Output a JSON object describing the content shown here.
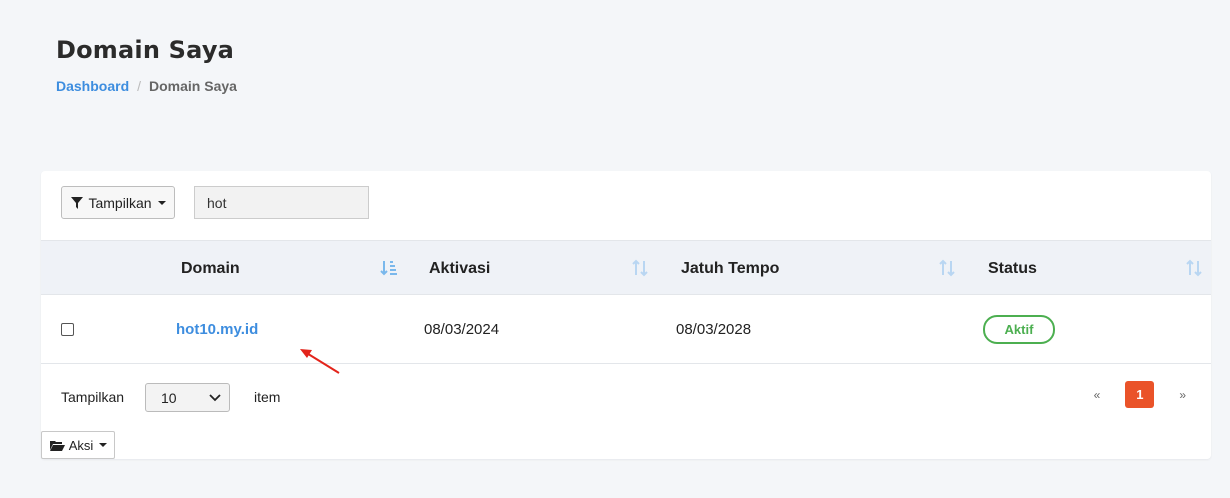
{
  "header": {
    "title": "Domain Saya",
    "breadcrumb": {
      "link": "Dashboard",
      "separator": "/",
      "current": "Domain Saya"
    }
  },
  "toolbar": {
    "filter_label": "Tampilkan",
    "search_value": "hot"
  },
  "table": {
    "columns": [
      "Domain",
      "Aktivasi",
      "Jatuh Tempo",
      "Status"
    ],
    "rows": [
      {
        "domain": "hot10.my.id",
        "activation": "08/03/2024",
        "due": "08/03/2028",
        "status": "Aktif"
      }
    ]
  },
  "footer": {
    "show_label": "Tampilkan",
    "per_page": "10",
    "item_label": "item",
    "pager_prev": "«",
    "current_page": "1",
    "pager_next": "»",
    "action_label": "Aksi"
  },
  "colors": {
    "accent": "#3d8ddf",
    "active_status": "#4caf50",
    "current_page": "#ea5329"
  }
}
